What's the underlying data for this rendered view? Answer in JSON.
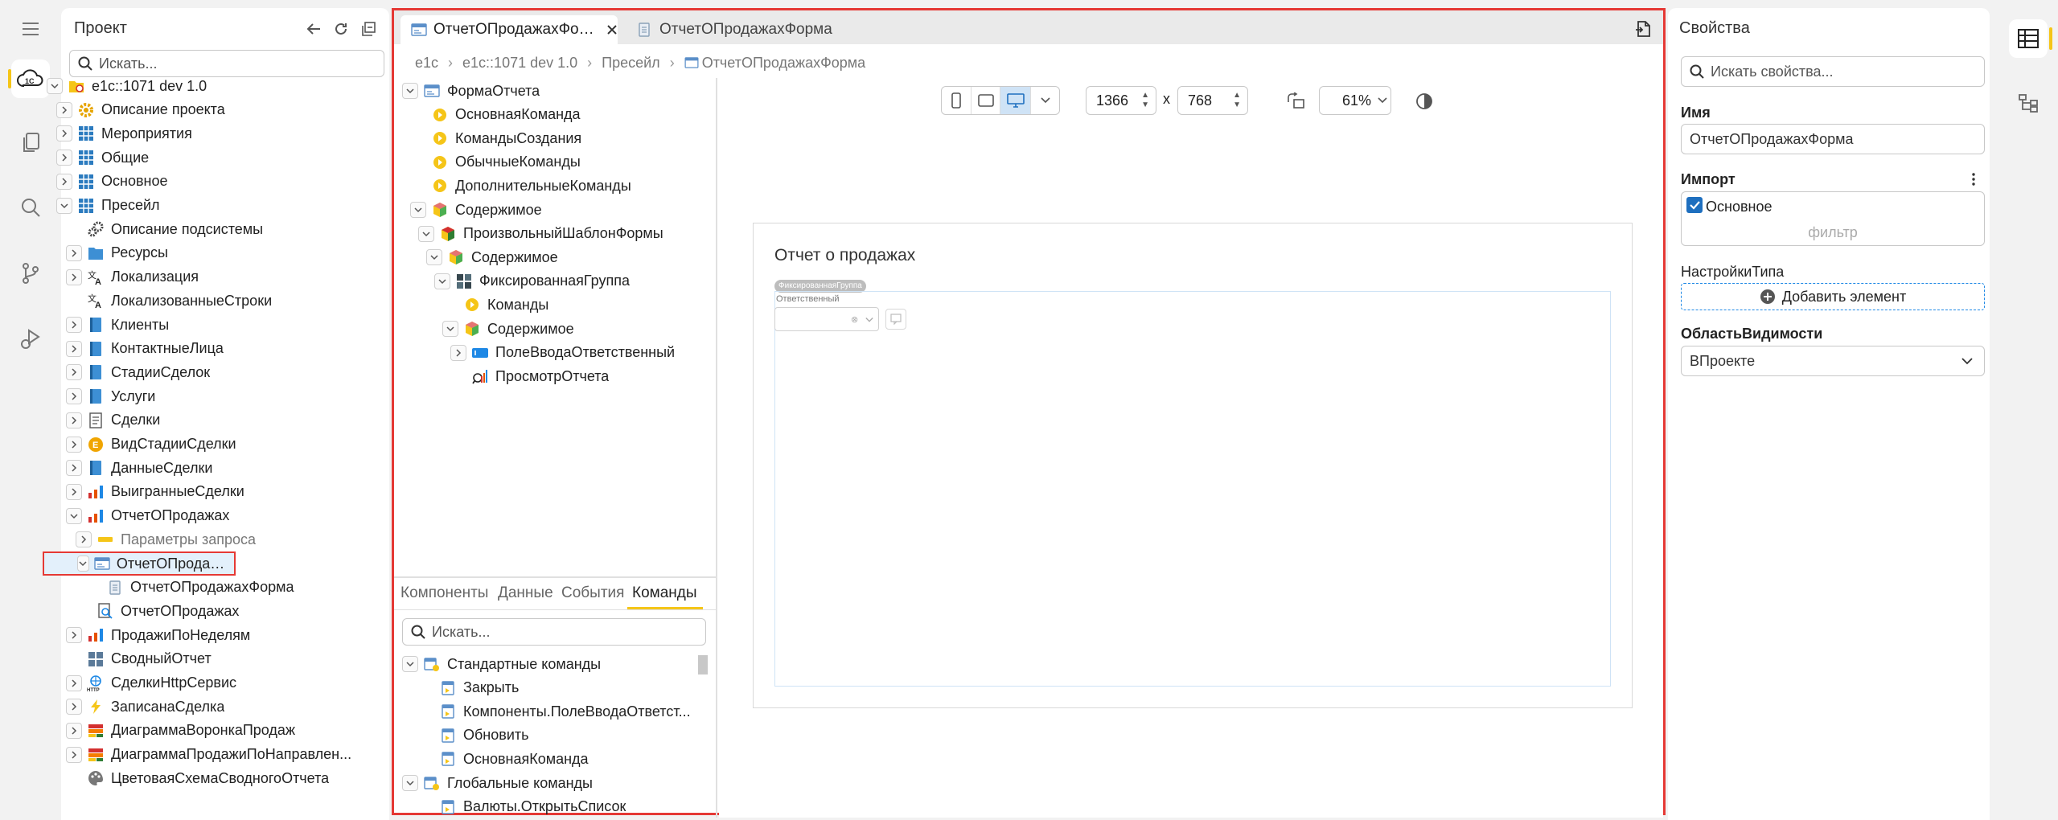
{
  "project": {
    "title": "Проект",
    "search_placeholder": "Искать...",
    "tree": [
      {
        "label": "e1c::1071 dev 1.0",
        "level": 0,
        "chev": "down",
        "icon": "project"
      },
      {
        "label": "Описание проекта",
        "level": 1,
        "chev": "right",
        "icon": "gear"
      },
      {
        "label": "Мероприятия",
        "level": 1,
        "chev": "right",
        "icon": "grid"
      },
      {
        "label": "Общие",
        "level": 1,
        "chev": "right",
        "icon": "grid"
      },
      {
        "label": "Основное",
        "level": 1,
        "chev": "right",
        "icon": "grid"
      },
      {
        "label": "Пресейл",
        "level": 1,
        "chev": "down",
        "icon": "grid"
      },
      {
        "label": "Описание подсистемы",
        "level": 2,
        "chev": "",
        "icon": "gears"
      },
      {
        "label": "Ресурсы",
        "level": 2,
        "chev": "right",
        "icon": "folder"
      },
      {
        "label": "Локализация",
        "level": 2,
        "chev": "right",
        "icon": "translate"
      },
      {
        "label": "ЛокализованныеСтроки",
        "level": 2,
        "chev": "",
        "icon": "translate"
      },
      {
        "label": "Клиенты",
        "level": 2,
        "chev": "right",
        "icon": "book"
      },
      {
        "label": "КонтактныеЛица",
        "level": 2,
        "chev": "right",
        "icon": "book"
      },
      {
        "label": "СтадииСделок",
        "level": 2,
        "chev": "right",
        "icon": "book"
      },
      {
        "label": "Услуги",
        "level": 2,
        "chev": "right",
        "icon": "book"
      },
      {
        "label": "Сделки",
        "level": 2,
        "chev": "right",
        "icon": "doc"
      },
      {
        "label": "ВидСтадииСделки",
        "level": 2,
        "chev": "right",
        "icon": "enum"
      },
      {
        "label": "ДанныеСделки",
        "level": 2,
        "chev": "right",
        "icon": "book"
      },
      {
        "label": "ВыигранныеСделки",
        "level": 2,
        "chev": "right",
        "icon": "chart"
      },
      {
        "label": "ОтчетОПродажах",
        "level": 2,
        "chev": "down",
        "icon": "chart"
      },
      {
        "label": "Параметры запроса",
        "level": 3,
        "chev": "right",
        "icon": "param"
      },
      {
        "label": "ОтчетОПродажахФорма",
        "level": 3,
        "chev": "down",
        "icon": "form",
        "selected": true
      },
      {
        "label": "ОтчетОПродажахФорма",
        "level": 4,
        "chev": "",
        "icon": "page"
      },
      {
        "label": "ОтчетОПродажах",
        "level": 3,
        "chev": "",
        "icon": "query"
      },
      {
        "label": "ПродажиПоНеделям",
        "level": 2,
        "chev": "right",
        "icon": "chart"
      },
      {
        "label": "СводныйОтчет",
        "level": 2,
        "chev": "",
        "icon": "pivot"
      },
      {
        "label": "СделкиHttpСервис",
        "level": 2,
        "chev": "right",
        "icon": "http"
      },
      {
        "label": "ЗаписанаСделка",
        "level": 2,
        "chev": "right",
        "icon": "bolt"
      },
      {
        "label": "ДиаграммаВоронкаПродаж",
        "level": 2,
        "chev": "right",
        "icon": "diagram"
      },
      {
        "label": "ДиаграммаПродажиПоНаправлен...",
        "level": 2,
        "chev": "right",
        "icon": "diagram"
      },
      {
        "label": "ЦветоваяСхемаСводногоОтчета",
        "level": 2,
        "chev": "",
        "icon": "palette"
      }
    ]
  },
  "editor": {
    "tabs": [
      {
        "label": "ОтчетОПродажахФорма",
        "active": true
      },
      {
        "label": "ОтчетОПродажахФорма",
        "active": false
      }
    ],
    "breadcrumbs": [
      "e1c",
      "e1c::1071 dev 1.0",
      "Пресейл",
      "ОтчетОПродажахФорма"
    ],
    "structure": [
      {
        "label": "ФормаОтчета",
        "level": 0,
        "chev": "down",
        "icon": "form"
      },
      {
        "label": "ОсновнаяКоманда",
        "level": 1,
        "chev": "",
        "icon": "cmd"
      },
      {
        "label": "КомандыСоздания",
        "level": 1,
        "chev": "",
        "icon": "cmd"
      },
      {
        "label": "ОбычныеКоманды",
        "level": 1,
        "chev": "",
        "icon": "cmd"
      },
      {
        "label": "ДополнительныеКоманды",
        "level": 1,
        "chev": "",
        "icon": "cmd"
      },
      {
        "label": "Содержимое",
        "level": 1,
        "chev": "down",
        "icon": "cube"
      },
      {
        "label": "ПроизвольныйШаблонФормы",
        "level": 2,
        "chev": "down",
        "icon": "cube2"
      },
      {
        "label": "Содержимое",
        "level": 3,
        "chev": "down",
        "icon": "cube"
      },
      {
        "label": "ФиксированнаяГруппа",
        "level": 4,
        "chev": "down",
        "icon": "group"
      },
      {
        "label": "Команды",
        "level": 5,
        "chev": "",
        "icon": "cmd"
      },
      {
        "label": "Содержимое",
        "level": 5,
        "chev": "down",
        "icon": "cube"
      },
      {
        "label": "ПолеВводаОтветственный",
        "level": 6,
        "chev": "right",
        "icon": "input"
      },
      {
        "label": "ПросмотрОтчета",
        "level": 6,
        "chev": "",
        "icon": "reportview"
      }
    ],
    "bottom_tabs": [
      "Компоненты",
      "Данные",
      "События",
      "Команды"
    ],
    "active_bottom_tab": "Команды",
    "commands_search_placeholder": "Искать...",
    "commands": [
      {
        "label": "Стандартные команды",
        "level": 0,
        "chev": "down",
        "icon": "cmdgroup"
      },
      {
        "label": "Закрыть",
        "level": 1,
        "chev": "",
        "icon": "cmdpage"
      },
      {
        "label": "Компоненты.ПолеВводаОтветст...",
        "level": 1,
        "chev": "",
        "icon": "cmdpage"
      },
      {
        "label": "Обновить",
        "level": 1,
        "chev": "",
        "icon": "cmdpage"
      },
      {
        "label": "ОсновнаяКоманда",
        "level": 1,
        "chev": "",
        "icon": "cmdpage"
      },
      {
        "label": "Глобальные команды",
        "level": 0,
        "chev": "down",
        "icon": "cmdgroup"
      },
      {
        "label": "Валюты.ОткрытьСписок",
        "level": 1,
        "chev": "",
        "icon": "cmdpage"
      }
    ],
    "toolbar": {
      "width": "1366",
      "height": "768",
      "times": "x",
      "zoom": "61%"
    },
    "form_preview": {
      "title": "Отчет о продажах",
      "group_label": "ФиксированнаяГруппа",
      "field_label": "Ответственный"
    }
  },
  "properties": {
    "title": "Свойства",
    "search_placeholder": "Искать свойства...",
    "name_label": "Имя",
    "name_value": "ОтчетОПродажахФорма",
    "import_label": "Импорт",
    "import_item": "Основное",
    "import_filter": "фильтр",
    "type_settings_label": "НастройкиТипа",
    "add_element_label": "Добавить элемент",
    "visibility_label": "ОбластьВидимости",
    "visibility_value": "ВПроекте"
  },
  "colors": {
    "accent": "#f5c518",
    "selection_border": "#e53935",
    "selection_bg": "#e3f0fb",
    "link_blue": "#1e88e5"
  }
}
